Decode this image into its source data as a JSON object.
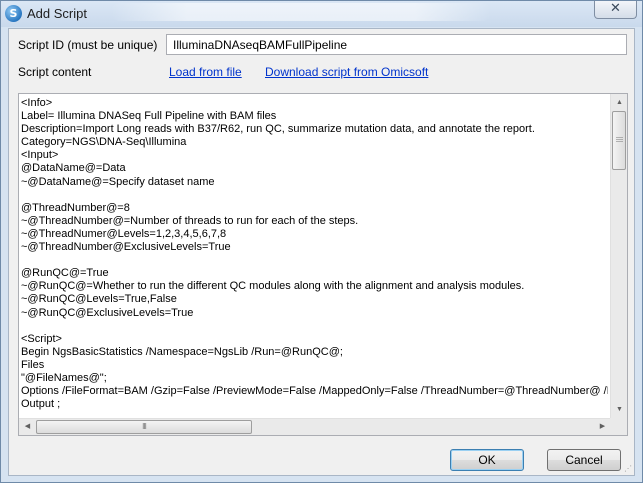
{
  "window": {
    "title": "Add Script",
    "close_icon": "close-icon",
    "app_icon": "app-icon"
  },
  "form": {
    "script_id_label": "Script ID (must be unique)",
    "script_id_value": "IlluminaDNAseqBAMFullPipeline",
    "script_content_label": "Script content",
    "load_link": "Load from file",
    "download_link": "Download script from Omicsoft"
  },
  "editor": {
    "content": "<Info>\nLabel= Illumina DNASeq Full Pipeline with BAM files\nDescription=Import Long reads with B37/R62, run QC, summarize mutation data, and annotate the report.\nCategory=NGS\\DNA-Seq\\Illumina\n<Input>\n@DataName@=Data\n~@DataName@=Specify dataset name\n\n@ThreadNumber@=8\n~@ThreadNumber@=Number of threads to run for each of the steps.\n~@ThreadNumer@Levels=1,2,3,4,5,6,7,8\n~@ThreadNumber@ExclusiveLevels=True\n\n@RunQC@=True\n~@RunQC@=Whether to run the different QC modules along with the alignment and analysis modules.\n~@RunQC@Levels=True,False\n~@RunQC@ExclusiveLevels=True\n\n<Script>\nBegin NgsBasicStatistics /Namespace=NgsLib /Run=@RunQC@;\nFiles\n\"@FileNames@\";\nOptions /FileFormat=BAM /Gzip=False /PreviewMode=False /MappedOnly=False /ThreadNumber=@ThreadNumber@ /Per...\nOutput ;",
    "hscroll_grip": "III"
  },
  "buttons": {
    "ok": "OK",
    "cancel": "Cancel"
  }
}
